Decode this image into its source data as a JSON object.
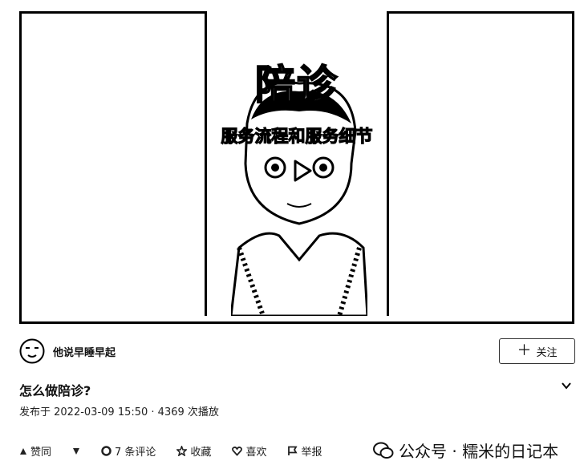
{
  "video": {
    "thumb_title": "陪诊",
    "thumb_subtitle": "服务流程和服务细节"
  },
  "author": {
    "name": "他说早睡早起"
  },
  "follow_label": "关注",
  "post": {
    "title": "怎么做陪诊?",
    "meta": "发布于 2022-03-09 15:50 · 4369 次播放"
  },
  "actions": {
    "like": "赞同",
    "comments": "7 条评论",
    "favorite": "收藏",
    "love": "喜欢",
    "report": "举报"
  },
  "watermark": {
    "text": "公众号 · 糯米的日记本"
  },
  "icons": [
    "play-icon",
    "plus-icon",
    "chevron-down-icon",
    "thumbs-up-icon",
    "thumbs-down-icon",
    "comment-icon",
    "star-icon",
    "heart-icon",
    "flag-icon",
    "wechat-icon"
  ]
}
